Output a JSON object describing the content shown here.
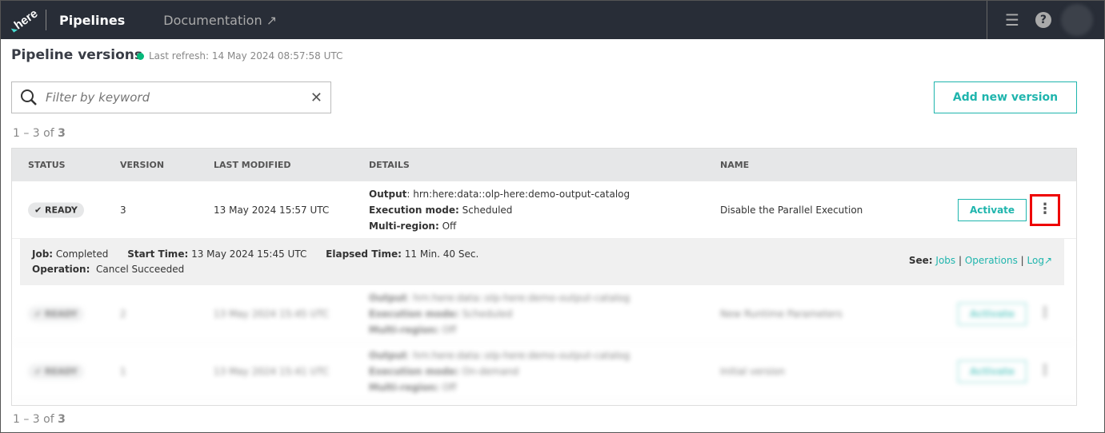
{
  "header": {
    "logo": "here",
    "nav_pipelines": "Pipelines",
    "nav_documentation": "Documentation",
    "external_icon": "↗"
  },
  "page": {
    "title": "Pipeline versions",
    "last_refresh": "Last refresh: 14 May 2024 08:57:58 UTC"
  },
  "search": {
    "placeholder": "Filter by keyword"
  },
  "add_button": "Add new version",
  "count_prefix": "1 – 3 of ",
  "count_total": "3",
  "columns": [
    "STATUS",
    "VERSION",
    "LAST MODIFIED",
    "DETAILS",
    "NAME"
  ],
  "rows": [
    {
      "status": "✔ READY",
      "version": "3",
      "modified": "13 May 2024 15:57 UTC",
      "output_label": "Output",
      "output": ": hrn:here:data::olp-here:demo-output-catalog",
      "exec_label": "Execution mode:",
      "exec": " Scheduled",
      "multi_label": "Multi-region:",
      "multi": " Off",
      "name": "Disable the Parallel Execution",
      "activate": "Activate"
    },
    {
      "status": "✔ READY",
      "version": "2",
      "modified": "13 May 2024 15:45 UTC",
      "output_label": "Output",
      "output": ": hrn:here:data::olp-here:demo-output-catalog",
      "exec_label": "Execution mode:",
      "exec": " Scheduled",
      "multi_label": "Multi-region:",
      "multi": " Off",
      "name": "New Runtime Parameters",
      "activate": "Activate"
    },
    {
      "status": "✔ READY",
      "version": "1",
      "modified": "13 May 2024 15:41 UTC",
      "output_label": "Output",
      "output": ": hrn:here:data::olp-here:demo-output-catalog",
      "exec_label": "Execution mode:",
      "exec": " On-demand",
      "multi_label": "Multi-region:",
      "multi": " Off",
      "name": "Initial version",
      "activate": "Activate"
    }
  ],
  "job": {
    "job_label": "Job:",
    "job": " Completed",
    "start_label": "Start Time:",
    "start": " 13 May 2024 15:45 UTC",
    "elapsed_label": "Elapsed Time:",
    "elapsed": " 11 Min. 40 Sec.",
    "op_label": "Operation:",
    "op": "  Cancel Succeeded",
    "see": "See:",
    "jobs": "Jobs",
    "operations": "Operations",
    "log": "Log"
  }
}
